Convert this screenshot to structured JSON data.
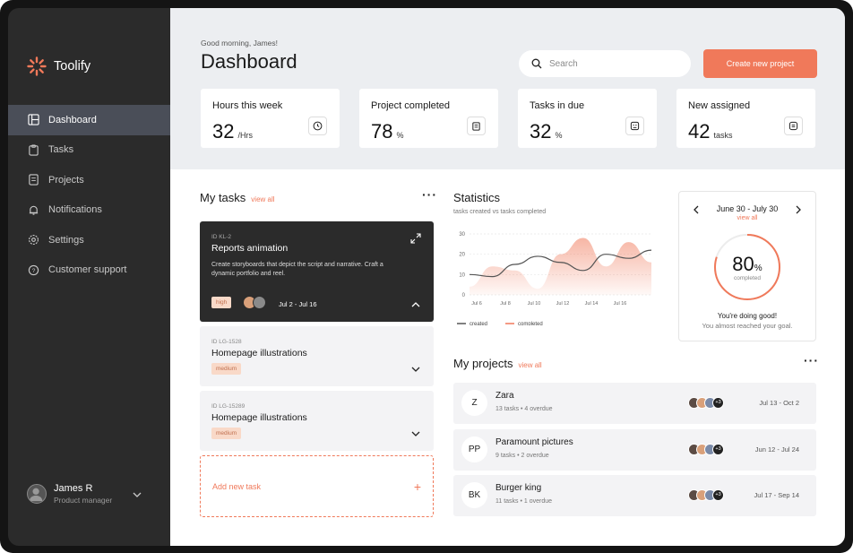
{
  "app": {
    "name": "Toolify"
  },
  "sidebar": {
    "items": [
      {
        "label": "Dashboard",
        "icon": "dashboard-icon"
      },
      {
        "label": "Tasks",
        "icon": "clipboard-icon"
      },
      {
        "label": "Projects",
        "icon": "document-icon"
      },
      {
        "label": "Notifications",
        "icon": "bell-icon"
      },
      {
        "label": "Settings",
        "icon": "gear-icon"
      },
      {
        "label": "Customer support",
        "icon": "help-icon"
      }
    ],
    "user": {
      "name": "James R",
      "role": "Product manager"
    }
  },
  "header": {
    "greeting": "Good morning, James!",
    "title": "Dashboard",
    "search_placeholder": "Search",
    "cta": "Create new project"
  },
  "stats": [
    {
      "label": "Hours this week",
      "value": "32",
      "unit": "/Hrs",
      "icon": "clock-icon"
    },
    {
      "label": "Project completed",
      "value": "78",
      "unit": "%",
      "icon": "clipboard-icon"
    },
    {
      "label": "Tasks in due",
      "value": "32",
      "unit": "%",
      "icon": "emoji-icon"
    },
    {
      "label": "New assigned",
      "value": "42",
      "unit": "tasks",
      "icon": "message-icon"
    }
  ],
  "tasks": {
    "title": "My tasks",
    "view_all": "view all",
    "items": [
      {
        "id": "ID KL-2",
        "name": "Reports animation",
        "desc": "Create storyboards that depict the script and narrative. Craft a dynamic portfolio and reel.",
        "tag": "high",
        "date": "Jul 2 - Jul 16"
      },
      {
        "id": "ID LG-1528",
        "name": "Homepage illustrations",
        "tag": "medium"
      },
      {
        "id": "ID LG-15289",
        "name": "Homepage illustrations",
        "tag": "medium"
      }
    ],
    "add": "Add new task"
  },
  "statistics": {
    "title": "Statistics",
    "subtitle": "tasks created vs tasks completed"
  },
  "chart_data": {
    "type": "area",
    "x": [
      "Jul 6",
      "Jul 8",
      "Jul 10",
      "Jul 12",
      "Jul 14",
      "Jul 16"
    ],
    "ylim": [
      0,
      30
    ],
    "yticks": [
      "30",
      "20",
      "10",
      "0"
    ],
    "series": [
      {
        "name": "created",
        "color": "#555555",
        "values": [
          10,
          9,
          15,
          19,
          16,
          12,
          20,
          18,
          22
        ]
      },
      {
        "name": "completed",
        "color": "#f0795a",
        "values": [
          4,
          14,
          12,
          3,
          20,
          28,
          14,
          26,
          16
        ]
      }
    ],
    "legend": "bottom-left"
  },
  "calendar": {
    "range": "June 30 - July 30",
    "view_all": "view all",
    "percent": "80",
    "unit": "%",
    "sub": "completed",
    "progress": 0.8,
    "msg": "You're doing good!",
    "msg2": "You almost reached your goal."
  },
  "projects": {
    "title": "My projects",
    "view_all": "view all",
    "items": [
      {
        "initial": "Z",
        "name": "Zara",
        "tasks": "13 tasks",
        "overdue": "4 overdue",
        "date": "Jul 13 - Oct 2",
        "extra": "+3"
      },
      {
        "initial": "PP",
        "name": "Paramount pictures",
        "tasks": "9 tasks",
        "overdue": "2 overdue",
        "date": "Jun 12 - Jul 24",
        "extra": "+3"
      },
      {
        "initial": "BK",
        "name": "Burger king",
        "tasks": "11 tasks",
        "overdue": "1 overdue",
        "date": "Jul 17 - Sep 14",
        "extra": "+3"
      }
    ]
  }
}
